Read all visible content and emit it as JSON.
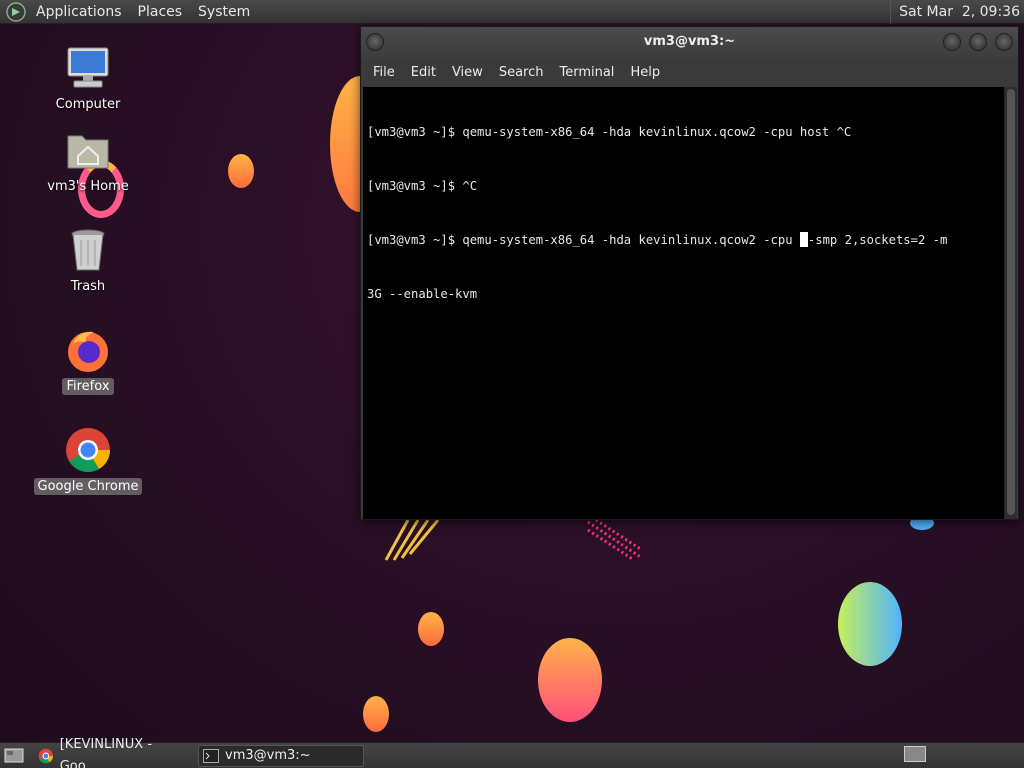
{
  "top_panel": {
    "menus": [
      "Applications",
      "Places",
      "System"
    ],
    "clock": "Sat Mar  2, 09:36"
  },
  "desktop": {
    "icons": [
      {
        "label": "Computer",
        "icon": "computer-icon"
      },
      {
        "label": "vm3's Home",
        "icon": "home-folder-icon"
      },
      {
        "label": "Trash",
        "icon": "trash-icon"
      },
      {
        "label": "Firefox",
        "icon": "firefox-icon"
      },
      {
        "label": "Google Chrome",
        "icon": "chrome-icon"
      }
    ]
  },
  "terminal": {
    "title": "vm3@vm3:~",
    "menu": [
      "File",
      "Edit",
      "View",
      "Search",
      "Terminal",
      "Help"
    ],
    "lines": [
      "[vm3@vm3 ~]$ qemu-system-x86_64 -hda kevinlinux.qcow2 -cpu host ^C",
      "[vm3@vm3 ~]$ ^C"
    ],
    "current_line_before_cursor": "[vm3@vm3 ~]$ qemu-system-x86_64 -hda kevinlinux.qcow2 -cpu ",
    "current_line_after_cursor": "-smp 2,sockets=2 -m",
    "wrapped_line": "3G --enable-kvm"
  },
  "taskbar": {
    "tasks": [
      {
        "label": "[KEVINLINUX - Goo...",
        "icon": "chrome-icon"
      },
      {
        "label": "vm3@vm3:~",
        "icon": "terminal-icon"
      }
    ]
  },
  "colors": {
    "desktop_bg": "#2a0f26",
    "panel": "#3b3b3b",
    "terminal_bg": "#000000"
  }
}
